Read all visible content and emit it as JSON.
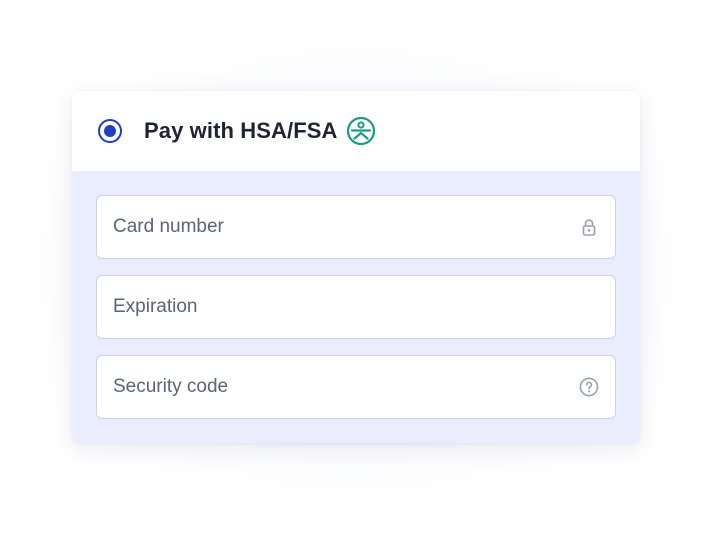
{
  "payment_option": {
    "label": "Pay with HSA/FSA",
    "selected": true,
    "brand_icon": "hsa-fsa-logo-icon"
  },
  "form": {
    "card_number": {
      "placeholder": "Card number",
      "value": "",
      "icon": "lock-icon"
    },
    "expiration": {
      "placeholder": "Expiration",
      "value": ""
    },
    "security_code": {
      "placeholder": "Security code",
      "value": "",
      "icon": "help-circle-icon"
    }
  },
  "colors": {
    "accent": "#1f3ec0",
    "brand_teal": "#1f9a8a",
    "panel_bg": "#e9edfd",
    "text_dark": "#1f2433"
  }
}
